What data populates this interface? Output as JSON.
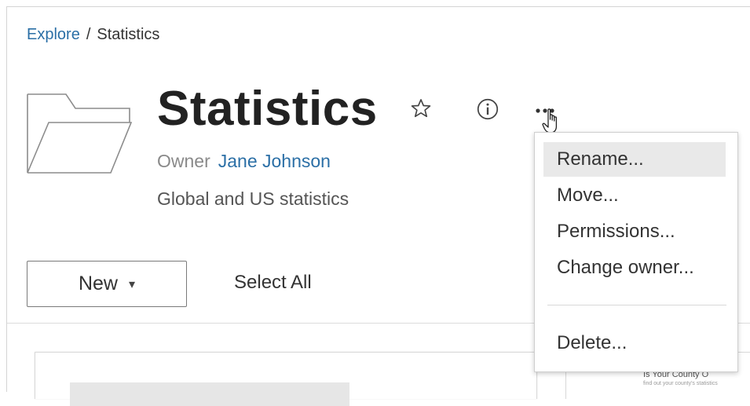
{
  "breadcrumb": {
    "root": "Explore",
    "separator": "/",
    "current": "Statistics"
  },
  "header": {
    "title": "Statistics",
    "owner_label": "Owner",
    "owner_name": "Jane Johnson",
    "description": "Global and US statistics",
    "icons": [
      "folder-icon",
      "star-icon",
      "info-icon",
      "more-actions-icon"
    ]
  },
  "toolbar": {
    "new_label": "New",
    "new_caret": "▾",
    "select_all_label": "Select All"
  },
  "actions_menu": {
    "items": [
      {
        "label": "Rename...",
        "hovered": true
      },
      {
        "label": "Move...",
        "hovered": false
      },
      {
        "label": "Permissions...",
        "hovered": false
      },
      {
        "label": "Change owner...",
        "hovered": false
      },
      {
        "label": "Delete...",
        "hovered": false
      }
    ]
  },
  "content": {
    "card_preview_title": "Is Your County O",
    "card_preview_subtitle": "find out your county's statistics"
  },
  "colors": {
    "link": "#2b6fa6",
    "hover_bg": "#e9e9e9",
    "text": "#333333",
    "muted": "#8a8a8a"
  }
}
